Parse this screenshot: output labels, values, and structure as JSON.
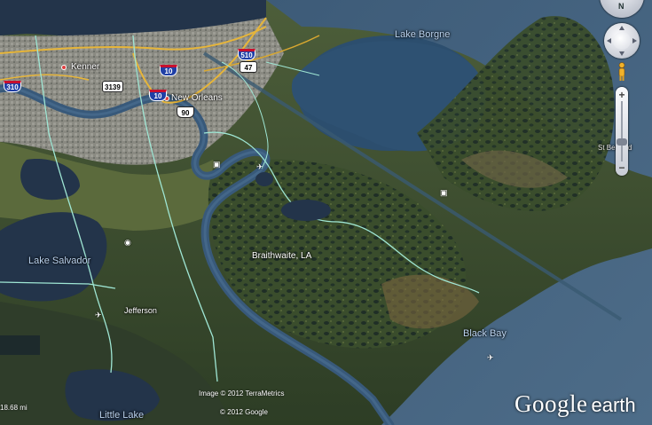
{
  "map": {
    "water_labels": {
      "lake_borgne": "Lake Borgne",
      "lake_salvador": "Lake Salvador",
      "black_bay": "Black Bay",
      "little_lake": "Little Lake"
    },
    "places": {
      "kenner": "Kenner",
      "new_orleans": "New Orleans",
      "braithwaite": "Braithwaite, LA",
      "jefferson": "Jefferson",
      "st_bernard": "St Bernard"
    },
    "shields": {
      "i310_west": "310",
      "i10_a": "10",
      "i10_b": "10",
      "i510": "510",
      "la3139": "3139",
      "us90": "90",
      "la47": "47"
    },
    "credits": {
      "imagery": "Image © 2012 TerraMetrics",
      "copyright": "© 2012 Google"
    },
    "logo": {
      "google": "Google",
      "earth": "earth"
    },
    "scale_text": "18.68 mi",
    "colors": {
      "deep_water": "#23344a",
      "lake_water": "#2c4e6e",
      "gulf_water": "#3e5c78",
      "marsh": "#35492a",
      "urban": "#8c8c86",
      "river": "#38597a",
      "interstate_road": "#e6b53a",
      "parish_boundary": "#9fe6d4"
    }
  },
  "controls": {
    "compass_label": "N",
    "zoom_in": "+",
    "zoom_out": "−"
  }
}
